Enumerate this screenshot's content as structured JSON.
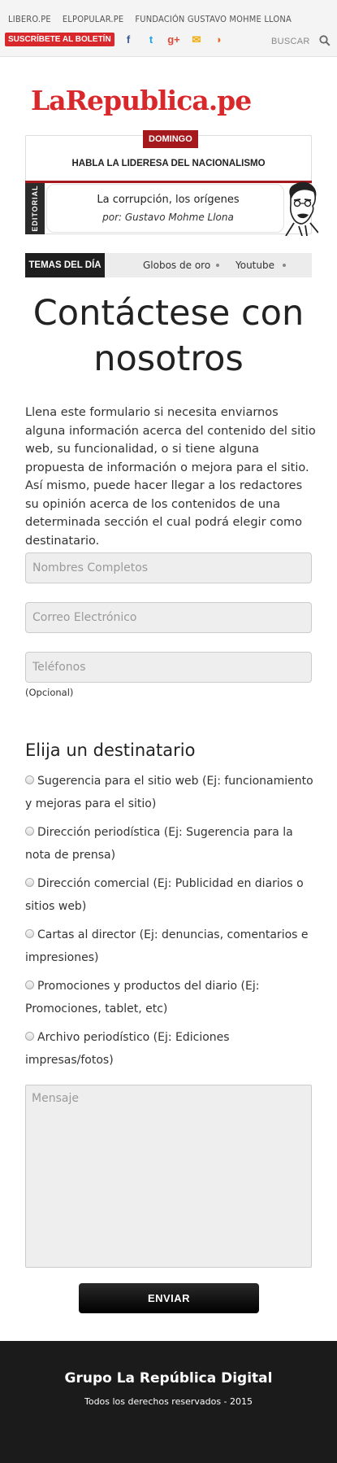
{
  "topbar": {
    "links": [
      "LIBERO.PE",
      "ELPOPULAR.PE",
      "FUNDACIÓN GUSTAVO MOHME LLONA"
    ],
    "subscribe_label": "SUSCRÍBETE AL BOLETÍN",
    "social_icons": [
      "facebook-icon",
      "twitter-icon",
      "google-plus-icon",
      "email-icon",
      "rss-icon"
    ],
    "social_glyphs": {
      "facebook": "f",
      "twitter": "t",
      "google_plus": "g+",
      "email": "✉",
      "rss": "◗"
    },
    "social_colors": {
      "facebook": "#3b5998",
      "twitter": "#1da1f2",
      "google_plus": "#dd4b39",
      "email": "#f2a900",
      "rss": "#f26522"
    },
    "search_label": "BUSCAR"
  },
  "logo": {
    "text": "LaRepublica.pe",
    "color": "#d8282b"
  },
  "sunday": {
    "badge": "DOMINGO",
    "headline": "HABLA LA LIDERESA DEL NACIONALISMO",
    "editorial_label": "EDITORIAL",
    "editorial_title": "La corrupción, los orígenes",
    "editorial_author": "por: Gustavo Mohme Llona"
  },
  "topics": {
    "label": "TEMAS DEL DÍA",
    "items": [
      "Globos de oro",
      "Youtube"
    ]
  },
  "page": {
    "title_line1": "Contáctese con",
    "title_line2": "nosotros",
    "intro": "Llena este formulario si necesita enviarnos alguna información acerca del contenido del sitio web, su funcionalidad, o si tiene alguna propuesta de información o mejora para el sitio. Así mismo, puede hacer llegar a los redactores su opinión acerca de los contenidos de una determinada sección el cual podrá elegir como destinatario."
  },
  "form": {
    "name_placeholder": "Nombres Completos",
    "email_placeholder": "Correo Electrónico",
    "phone_placeholder": "Teléfonos",
    "phone_note": "(Opcional)",
    "recipient_title": "Elija un destinatario",
    "options": [
      "Sugerencia para el sitio web (Ej: funcionamiento y mejoras para el sitio)",
      "Dirección periodística (Ej: Sugerencia para la nota de prensa)",
      "Dirección comercial (Ej: Publicidad en diarios o sitios web)",
      "Cartas al director (Ej: denuncias, comentarios e impresiones)",
      "Promociones y productos del diario (Ej: Promociones, tablet, etc)",
      "Archivo periodístico (Ej: Ediciones impresas/fotos)"
    ],
    "message_placeholder": "Mensaje",
    "send_label": "ENVIAR"
  },
  "footer": {
    "title": "Grupo La República Digital",
    "subtitle": "Todos los derechos reservados - 2015"
  }
}
